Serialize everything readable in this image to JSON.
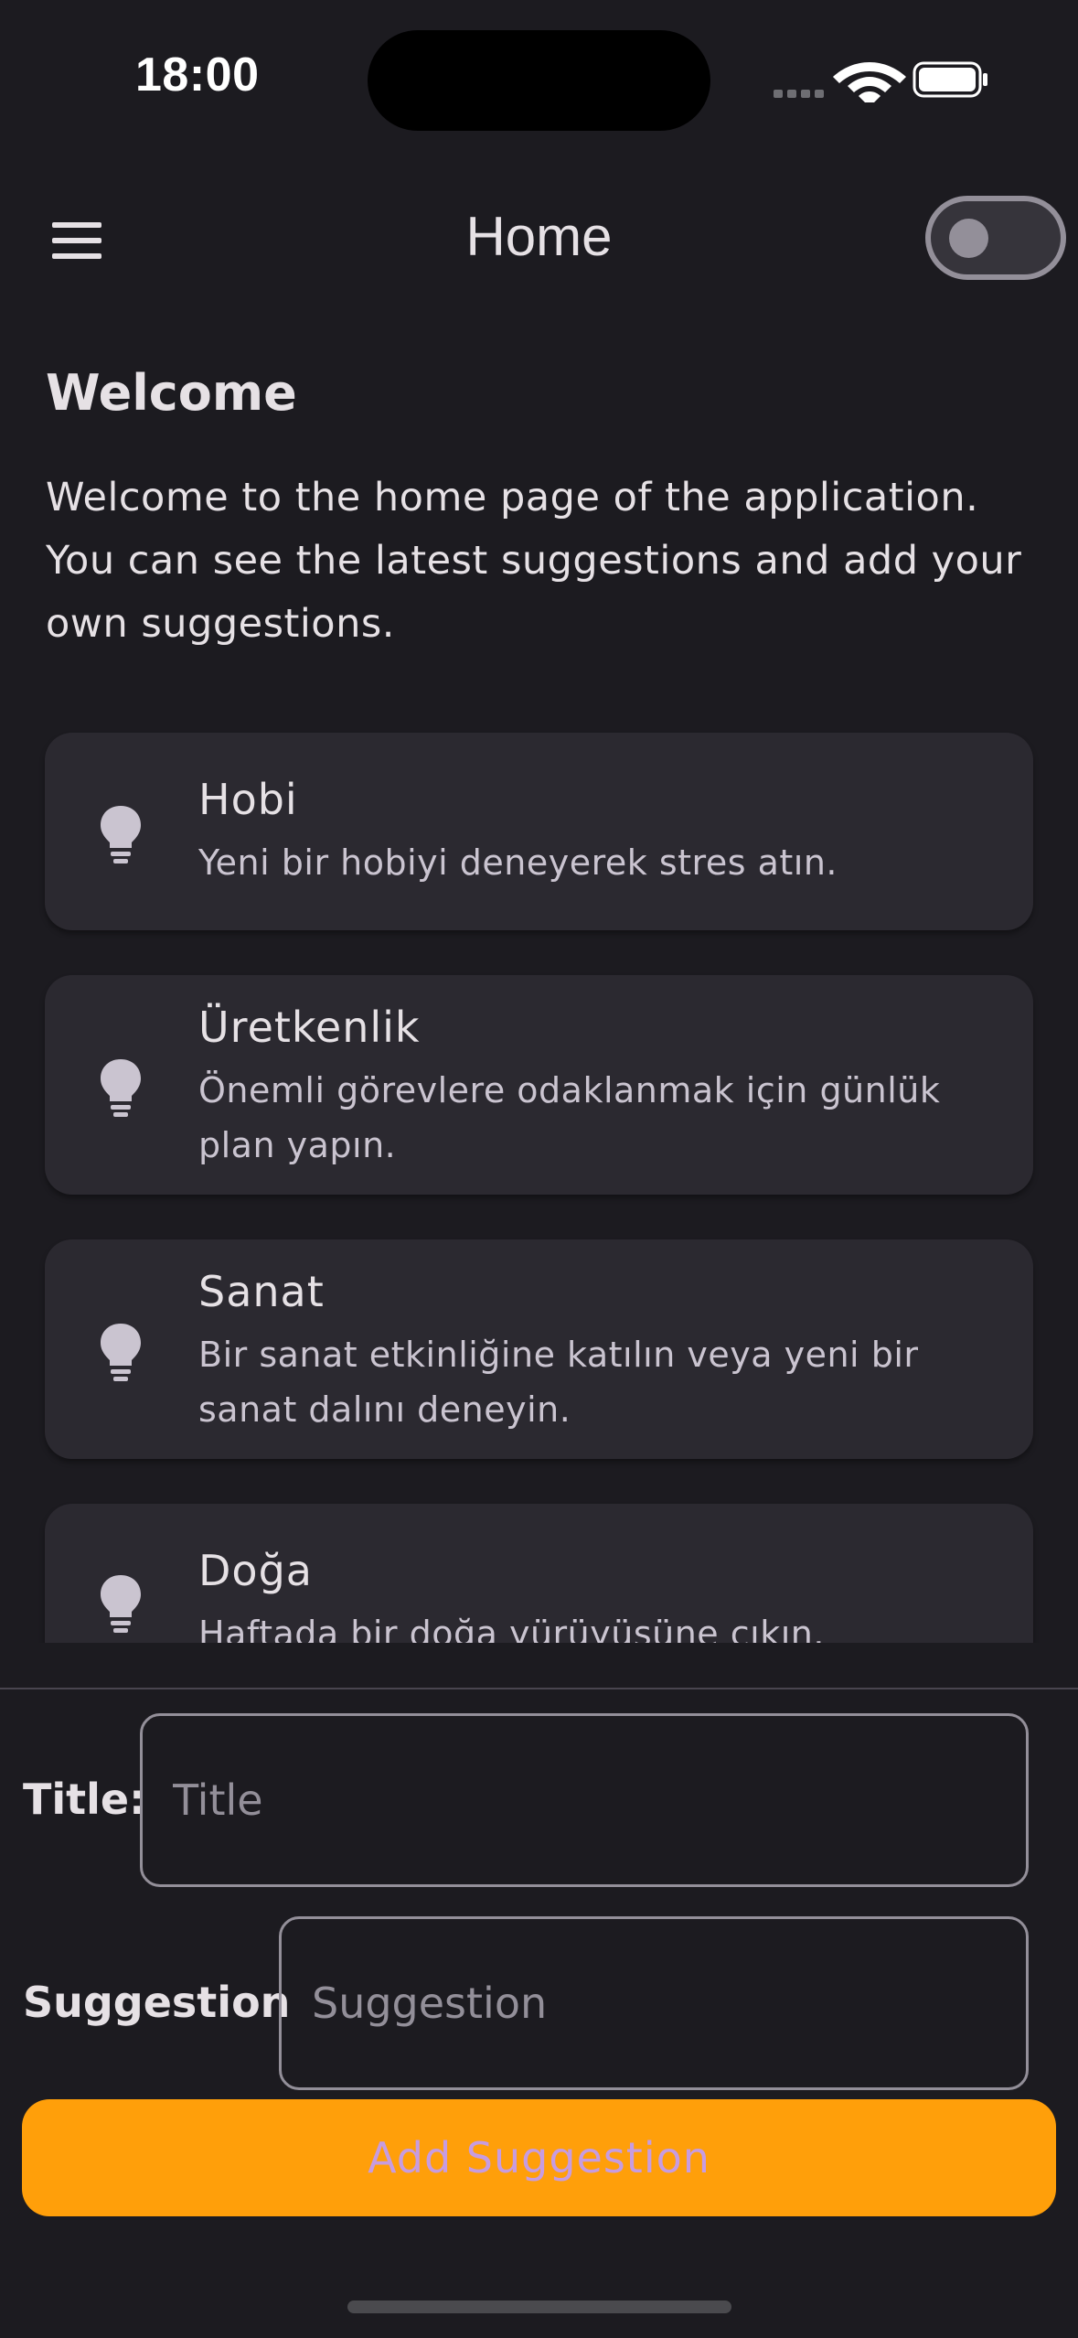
{
  "status_bar": {
    "time": "18:00",
    "icons": [
      "cellular-signal-icon",
      "wifi-icon",
      "battery-icon"
    ]
  },
  "app_bar": {
    "title": "Home",
    "menu_icon": "hamburger-menu-icon",
    "toggle_on": false
  },
  "welcome": {
    "title": "Welcome",
    "text": "Welcome to the home page of the application. You can see the latest suggestions and add your own suggestions."
  },
  "suggestions": [
    {
      "title": "Hobi",
      "description": "Yeni bir hobiyi deneyerek stres atın.",
      "icon": "lightbulb-icon"
    },
    {
      "title": "Üretkenlik",
      "description": "Önemli görevlere odaklanmak için günlük plan yapın.",
      "icon": "lightbulb-icon"
    },
    {
      "title": "Sanat",
      "description": "Bir sanat etkinliğine katılın veya yeni bir sanat dalını deneyin.",
      "icon": "lightbulb-icon"
    },
    {
      "title": "Doğa",
      "description": "Haftada bir doğa yürüyüşüne çıkın.",
      "icon": "lightbulb-icon"
    }
  ],
  "form": {
    "title_label": "Title:",
    "title_placeholder": "Title",
    "title_value": "",
    "suggestion_label": "Suggestion",
    "suggestion_placeholder": "Suggestion",
    "suggestion_value": "",
    "button_label": "Add Suggestion"
  },
  "colors": {
    "background": "#1c1b20",
    "card": "#2b2930",
    "accent": "#ff9f0a",
    "button_text": "#c79ce0"
  }
}
